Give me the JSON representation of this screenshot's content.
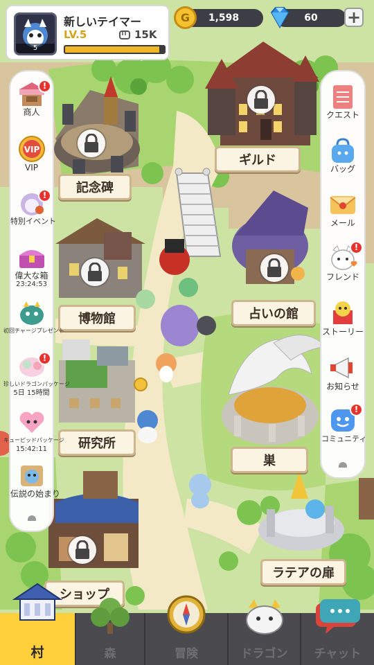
{
  "player": {
    "name": "新しいテイマー",
    "level_text": "LV.5",
    "avatar_level": "5",
    "power": "15K",
    "exp_fraction": 0.95
  },
  "currency": {
    "gold_symbol": "G",
    "gold": "1,598",
    "gems": "60",
    "add_label": "+"
  },
  "buildings": {
    "monument": "記念碑",
    "guild": "ギルド",
    "museum": "博物館",
    "fortune": "占いの館",
    "lab": "研究所",
    "nest": "巣",
    "shop": "ショップ",
    "ratea": "ラテアの扉"
  },
  "left_menu": [
    {
      "label": "商人",
      "icon": "merchant-stall-icon"
    },
    {
      "label": "VIP",
      "icon": "vip-badge-icon",
      "icon_text": "VIP"
    },
    {
      "label": "特別イベント",
      "icon": "special-event-icon"
    },
    {
      "label": "偉大な箱",
      "timer": "23:24:53",
      "icon": "treasure-chest-icon"
    },
    {
      "label": "初回チャージプレゼント",
      "icon": "first-charge-dragon-icon"
    },
    {
      "label": "珍しいドラゴンパッケージ",
      "timer": "5日 15時間",
      "icon": "rare-dragon-package-icon"
    },
    {
      "label": "キューピッドパッケージ",
      "timer": "15:42:11",
      "icon": "cupid-package-icon"
    },
    {
      "label": "伝説の始まり",
      "icon": "legend-start-icon"
    }
  ],
  "right_menu": [
    {
      "label": "クエスト",
      "icon": "quest-scroll-icon"
    },
    {
      "label": "バッグ",
      "icon": "bag-icon"
    },
    {
      "label": "メール",
      "icon": "mail-icon"
    },
    {
      "label": "フレンド",
      "icon": "friend-cat-icon"
    },
    {
      "label": "ストーリー",
      "icon": "story-book-icon"
    },
    {
      "label": "お知らせ",
      "icon": "megaphone-icon"
    },
    {
      "label": "コミュニティ",
      "icon": "community-chat-icon"
    }
  ],
  "badge_text": "!",
  "nav": [
    {
      "label": "村",
      "icon": "village-house-icon",
      "active": true
    },
    {
      "label": "森",
      "icon": "forest-tree-icon",
      "active": false
    },
    {
      "label": "冒険",
      "icon": "compass-icon",
      "active": false
    },
    {
      "label": "ドラゴン",
      "icon": "dragon-head-icon",
      "active": false
    },
    {
      "label": "チャット",
      "icon": "chat-bubble-icon",
      "active": false
    }
  ],
  "colors": {
    "accent_yellow": "#ffcf3c",
    "badge_red": "#e8322e",
    "path": "#f3e9c6",
    "grass": "#9fd16a",
    "cliff": "#d6c29c"
  }
}
